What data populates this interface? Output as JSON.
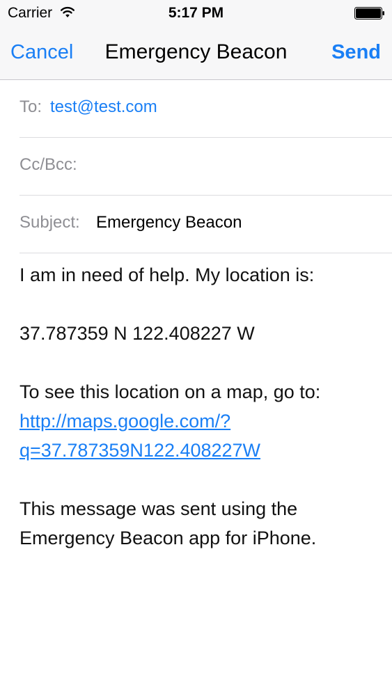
{
  "status_bar": {
    "carrier": "Carrier",
    "time": "5:17 PM",
    "icons": [
      "wifi-icon",
      "battery-icon"
    ]
  },
  "nav": {
    "cancel_label": "Cancel",
    "title": "Emergency Beacon",
    "send_label": "Send"
  },
  "fields": {
    "to_label": "To:",
    "to_value": "test@test.com",
    "ccbcc_label": "Cc/Bcc:",
    "subject_label": "Subject:",
    "subject_value": "Emergency Beacon"
  },
  "body": {
    "line1": "I am in need of help. My location is:",
    "coordinates": "37.787359 N 122.408227 W",
    "map_intro": "To see this location on a map, go to:",
    "map_link_1": "http://maps.google.com/?",
    "map_link_2": "q=37.787359N122.408227W",
    "footer": "This message was sent using the Emergency Beacon app for iPhone."
  },
  "colors": {
    "accent": "#1a7ff5",
    "label_gray": "#8e8e93",
    "nav_bg": "#f7f7f8",
    "separator": "#dcdcdf"
  }
}
